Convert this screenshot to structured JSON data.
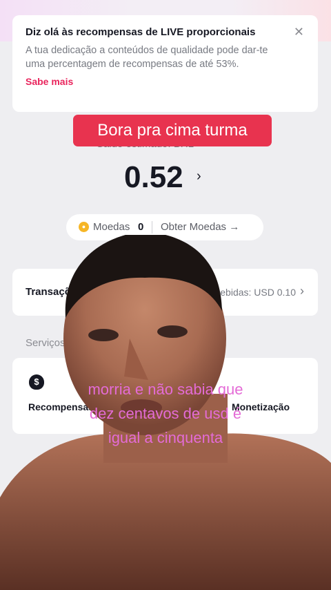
{
  "banner": {
    "title": "Diz olá às recompensas de LIVE proporcionais",
    "description": "A tua dedicação a conteúdos de qualidade pode dar-te uma percentagem de recompensas de até 53%.",
    "link": "Sabe mais",
    "close_icon": "close-icon"
  },
  "overlay_top": "Bora pra cima turma",
  "balance": {
    "label": "Saldo estimado: BRL",
    "amount": "0.52"
  },
  "coins": {
    "label": "Moedas",
    "value": "0",
    "get_link": "Obter Moedas →"
  },
  "transactions": {
    "label": "Transações",
    "value": "Recebidas: USD 0.10"
  },
  "services": {
    "heading": "Serviços",
    "items": [
      {
        "label": "Recompensas",
        "icon": "money-bag-icon"
      },
      {
        "label": "Monetização"
      }
    ]
  },
  "overlay_bottom": {
    "line1": "morria e não sabia que",
    "line2": "dez centavos de usd é",
    "line3": "igual a cinquenta"
  },
  "colors": {
    "accent": "#e9245c",
    "caption_bg": "#e8334f",
    "caption_text": "#e46bd6"
  }
}
